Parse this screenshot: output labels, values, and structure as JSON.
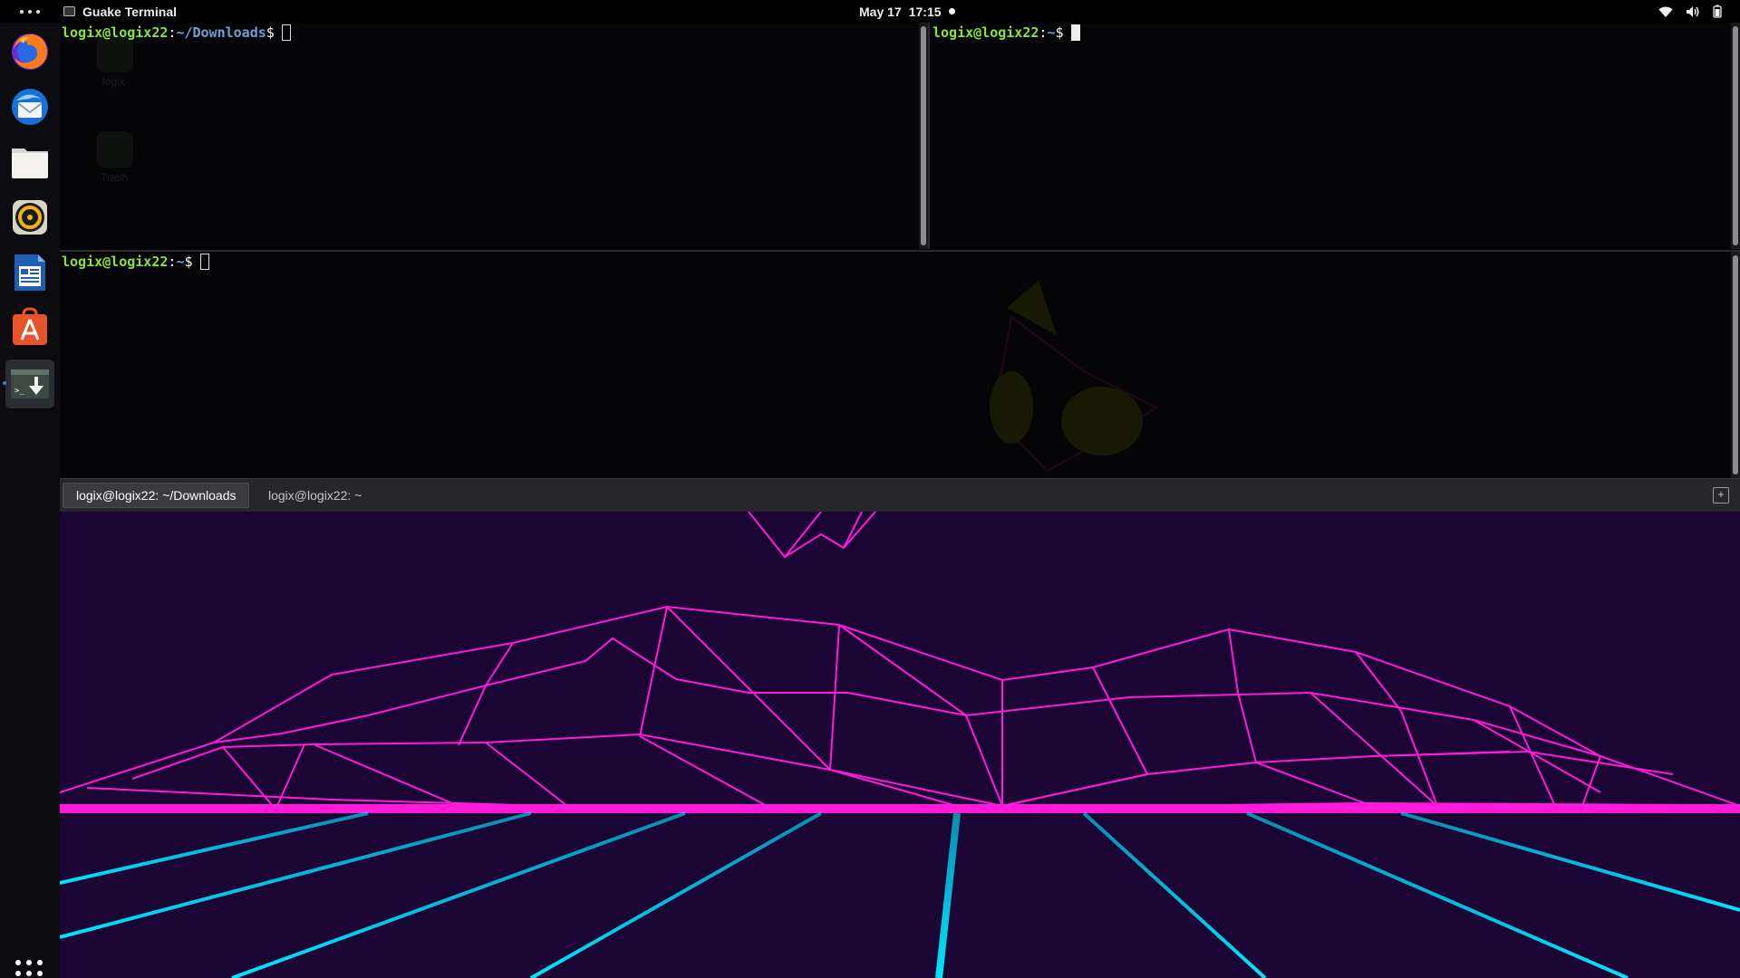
{
  "topbar": {
    "app_name": "Guake Terminal",
    "date": "May 17",
    "time": "17:15"
  },
  "dock": {
    "items": [
      "firefox-icon",
      "thunderbird-icon",
      "files-icon",
      "rhythmbox-icon",
      "writer-icon",
      "software-icon",
      "guake-icon"
    ]
  },
  "desktop": {
    "icon1_label": "logix",
    "icon2_label": "Trash"
  },
  "terminal": {
    "panes": [
      {
        "user": "logix@logix22",
        "sep": ":",
        "path": "~/Downloads",
        "dollar": "$"
      },
      {
        "user": "logix@logix22",
        "sep": ":",
        "path": "~",
        "dollar": "$"
      },
      {
        "user": "logix@logix22",
        "sep": ":",
        "path": "~",
        "dollar": "$"
      }
    ]
  },
  "tabs": {
    "tab1": "logix@logix22: ~/Downloads",
    "tab2": "logix@logix22: ~"
  },
  "colors": {
    "prompt_user": "#8ae234",
    "prompt_path": "#729fcf",
    "wallpaper_bg": "#1a0535",
    "mountain": "#ff1ad9",
    "grid": "#00e5ff"
  }
}
